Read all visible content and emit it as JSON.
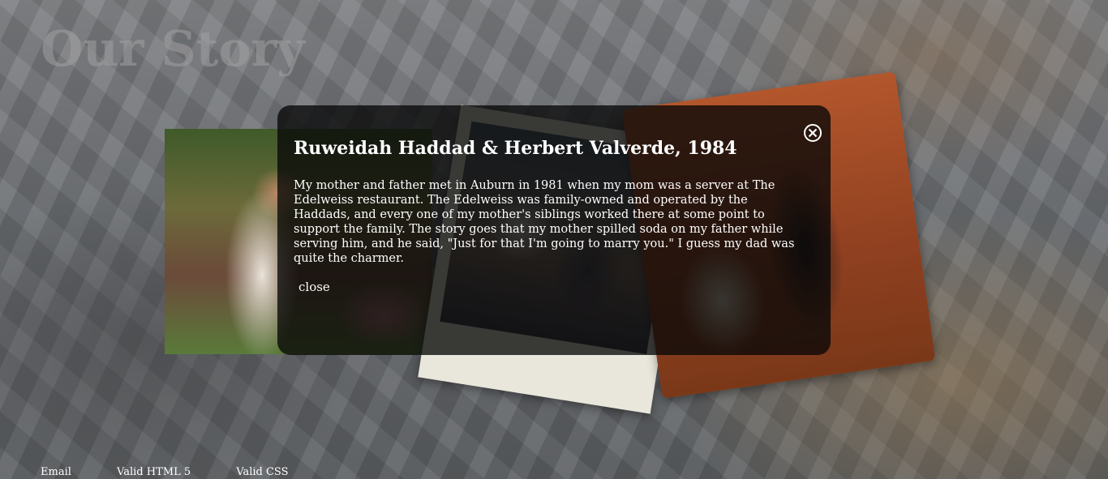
{
  "page": {
    "title": "Our Story"
  },
  "modal": {
    "heading": "Ruweidah Haddad & Herbert Valverde, 1984",
    "body": "My mother and father met in Auburn in 1981 when my mom was a server at The Edelweiss restaurant. The Edelweiss was family-owned and operated by the Haddads, and every one of my mother's siblings worked there at some point to support the family. The story goes that my mother spilled soda on my father while serving him, and he said, \"Just for that I'm going to marry you.\" I guess my dad was quite the charmer.",
    "close_label": "close",
    "close_icon": "close-circle-x-icon"
  },
  "footer": {
    "links": [
      "Email",
      "Valid HTML 5",
      "Valid CSS"
    ]
  },
  "colors": {
    "modal_background": "#080808",
    "text": "#ffffff",
    "title": "#a0a0a0"
  }
}
